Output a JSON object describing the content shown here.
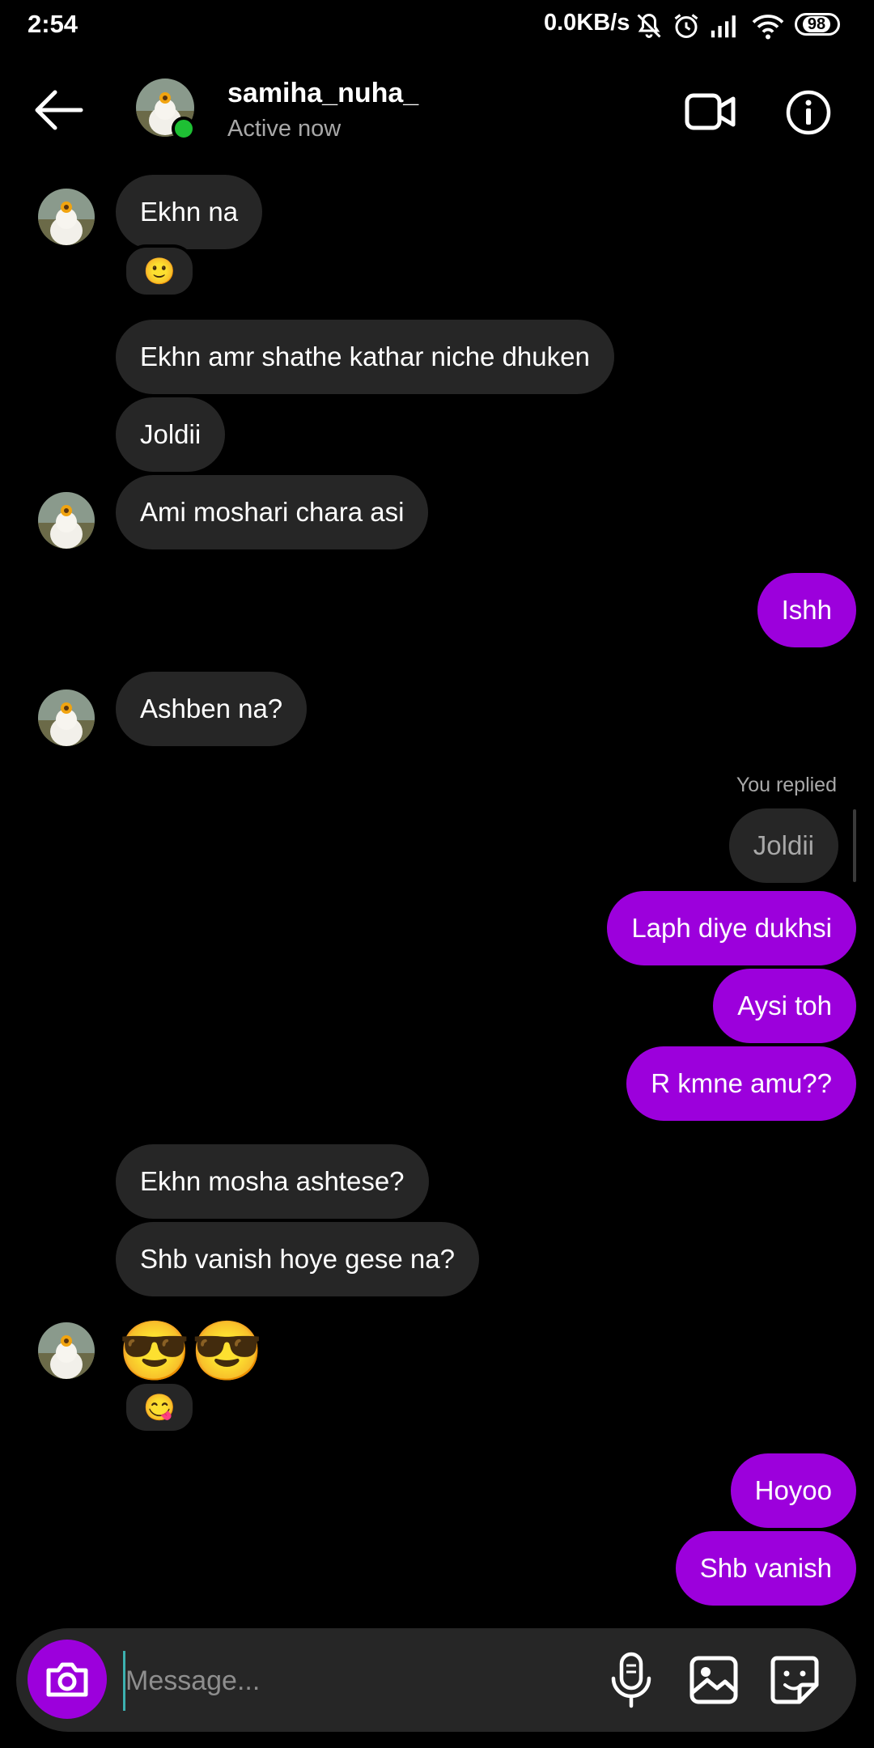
{
  "status_bar": {
    "time": "2:54",
    "net_speed": "0.0KB/s",
    "battery": "98"
  },
  "header": {
    "username": "samiha_nuha_",
    "status": "Active now"
  },
  "messages": [
    {
      "text": "Ekhn na",
      "reaction": "🙂"
    },
    {
      "text": "Ekhn amr shathe kathar niche dhuken"
    },
    {
      "text": "Joldii"
    },
    {
      "text": "Ami moshari chara asi"
    },
    {
      "text": "Ishh"
    },
    {
      "text": "Ashben na?"
    },
    {
      "reply_label": "You replied",
      "quoted": "Joldii"
    },
    {
      "text": "Laph diye dukhsi"
    },
    {
      "text": "Aysi toh"
    },
    {
      "text": "R kmne amu??"
    },
    {
      "text": "Ekhn mosha ashtese?"
    },
    {
      "text": "Shb vanish hoye gese na?"
    },
    {
      "text": "😎😎",
      "reaction": "😋"
    },
    {
      "text": "Hoyoo"
    },
    {
      "text": "Shb vanish"
    }
  ],
  "composer": {
    "placeholder": "Message..."
  },
  "colors": {
    "outgoing_bubble": "#9c00dc",
    "incoming_bubble": "#262626",
    "active_dot": "#1ec034"
  }
}
